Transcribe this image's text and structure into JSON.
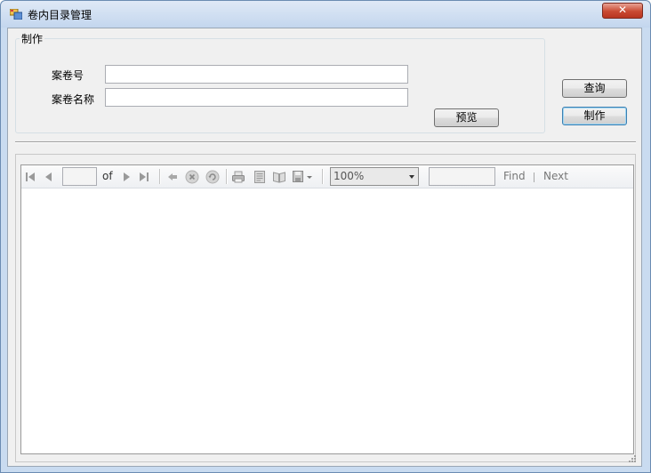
{
  "window": {
    "title": "卷内目录管理",
    "close_glyph": "✕"
  },
  "group": {
    "title": "制作",
    "case_no_label": "案卷号",
    "case_no_value": "",
    "case_name_label": "案卷名称",
    "case_name_value": ""
  },
  "buttons": {
    "preview": "预览",
    "query": "查询",
    "make": "制作"
  },
  "viewer": {
    "page_of": "of",
    "page_value": "",
    "zoom": "100%",
    "find_value": "",
    "find_label": "Find",
    "next_label": "Next"
  },
  "colors": {
    "title_bar": "#c9dbf0",
    "close_button": "#c94a33",
    "client_background": "#f0f0f0",
    "default_button_border": "#3c7fb1"
  },
  "icons": {
    "app": "window-app-icon",
    "first_page": "first-page-icon",
    "previous_page": "previous-page-icon",
    "next_page": "next-page-icon",
    "last_page": "last-page-icon",
    "back": "back-icon",
    "stop": "stop-icon",
    "refresh": "refresh-icon",
    "print": "print-icon",
    "print_layout": "print-layout-icon",
    "page_setup": "page-setup-icon",
    "export": "export-icon"
  }
}
